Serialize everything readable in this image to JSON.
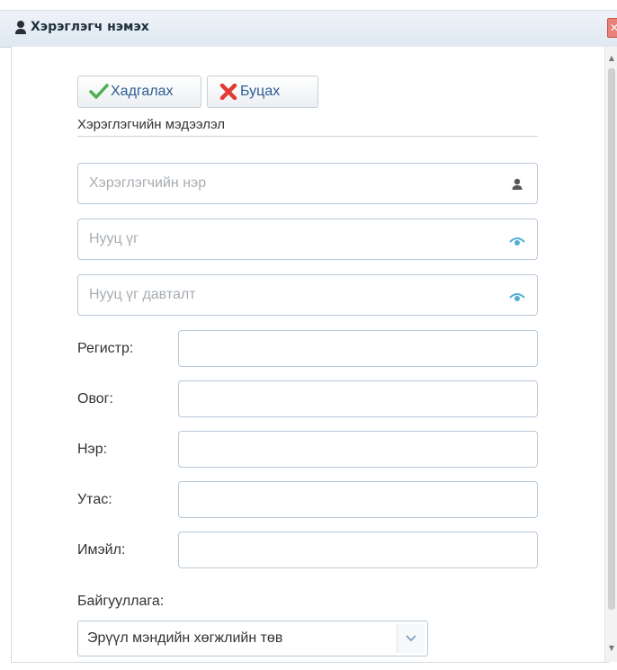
{
  "window": {
    "title": "Хэрэглэгч нэмэх",
    "close_glyph": "✕"
  },
  "toolbar": {
    "save_label": "Хадгалах",
    "cancel_label": "Буцах"
  },
  "section": {
    "title": "Хэрэглэгчийн мэдээлэл"
  },
  "fields": {
    "username_placeholder": "Хэрэглэгчийн нэр",
    "password_placeholder": "Нууц үг",
    "password_confirm_placeholder": "Нууц үг давталт",
    "register_label": "Регистр:",
    "surname_label": "Овог:",
    "name_label": "Нэр:",
    "phone_label": "Утас:",
    "email_label": "Имэйл:",
    "register_value": "",
    "surname_value": "",
    "name_value": "",
    "phone_value": "",
    "email_value": ""
  },
  "organization": {
    "label": "Байгууллага:",
    "selected": "Эрүүл мэндийн хөгжлийн төв"
  },
  "icons": {
    "title": "user-icon",
    "save": "checkmark-icon",
    "cancel": "cross-icon",
    "username": "user-icon",
    "password": "eye-icon",
    "password_confirm": "eye-icon",
    "select": "chevron-down-icon"
  },
  "colors": {
    "accent_text": "#2d5b93",
    "save_icon": "#4caf50",
    "cancel_icon": "#e53935",
    "eye_icon": "#4fb0d6"
  }
}
